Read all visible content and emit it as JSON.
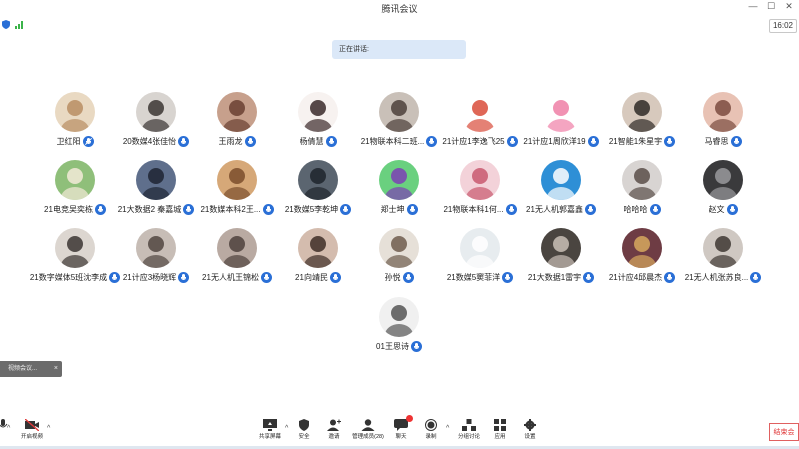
{
  "window": {
    "title": "腾讯会议",
    "minimize": "—",
    "maximize": "☐",
    "close": "✕"
  },
  "status": {
    "time": "16:02",
    "speaking_label": "正在讲话:"
  },
  "participants": [
    {
      "name": "卫红阳",
      "mic": "muted",
      "bg": "#e9d9c2",
      "fg": "#b88d63"
    },
    {
      "name": "20数媒4张佳怡",
      "mic": "on",
      "bg": "#d8d4d0",
      "fg": "#3b3533"
    },
    {
      "name": "王雨龙",
      "mic": "on",
      "bg": "#c7a08c",
      "fg": "#6a3f31"
    },
    {
      "name": "杨倩慧",
      "mic": "on",
      "bg": "#f7f2f0",
      "fg": "#3a2a2a"
    },
    {
      "name": "21物联本科二班...",
      "mic": "on",
      "bg": "#c9c0b8",
      "fg": "#4c3f39"
    },
    {
      "name": "21计应1李逸飞25",
      "mic": "on",
      "bg": "#ffffff",
      "fg": "#d94c3a"
    },
    {
      "name": "21计应1周欣洋19",
      "mic": "on",
      "bg": "#ffffff",
      "fg": "#ef7fa6"
    },
    {
      "name": "21智能1朱星宇",
      "mic": "on",
      "bg": "#d7c9bd",
      "fg": "#2f2a27"
    },
    {
      "name": "马睿思",
      "mic": "on",
      "bg": "#e8c2b4",
      "fg": "#7b4b3f"
    },
    {
      "name": "21电竞吴奕栋",
      "mic": "on",
      "bg": "#8fbf7a",
      "fg": "#f3ead8"
    },
    {
      "name": "21大数据2 秦嘉城",
      "mic": "on",
      "bg": "#5f6f8c",
      "fg": "#1e2533"
    },
    {
      "name": "21数媒本科2王...",
      "mic": "on",
      "bg": "#d6a878",
      "fg": "#7b4e2c"
    },
    {
      "name": "21数媒5李乾坤",
      "mic": "on",
      "bg": "#5b6570",
      "fg": "#1f252c"
    },
    {
      "name": "郑士坤",
      "mic": "on",
      "bg": "#6ad07f",
      "fg": "#7d3fb5"
    },
    {
      "name": "21物联本科1何...",
      "mic": "on",
      "bg": "#f3d2d9",
      "fg": "#c8596e"
    },
    {
      "name": "21无人机郭嘉鑫",
      "mic": "on",
      "bg": "#2e8fd6",
      "fg": "#ffffff"
    },
    {
      "name": "哈哈哈",
      "mic": "on",
      "bg": "#d8d4d2",
      "fg": "#5a4e49"
    },
    {
      "name": "赵文",
      "mic": "on",
      "bg": "#3a3a3c",
      "fg": "#9a9a9c"
    },
    {
      "name": "21数字媒体5班沈李成",
      "mic": "on",
      "bg": "#dcd6d0",
      "fg": "#3b3532"
    },
    {
      "name": "21计应3杨晓辉",
      "mic": "on",
      "bg": "#c7bdb6",
      "fg": "#514741"
    },
    {
      "name": "21无人机王锦松",
      "mic": "on",
      "bg": "#b9aaa2",
      "fg": "#4e423d"
    },
    {
      "name": "21向靖民",
      "mic": "on",
      "bg": "#d4bcae",
      "fg": "#3e2e27"
    },
    {
      "name": "孙悦",
      "mic": "on",
      "bg": "#e6e0d8",
      "fg": "#6e5c4e"
    },
    {
      "name": "21数媒5窦菲洋",
      "mic": "on",
      "bg": "#e7ecef",
      "fg": "#ffffff"
    },
    {
      "name": "21大数据1雷宇",
      "mic": "on",
      "bg": "#4a4540",
      "fg": "#c9bfb6"
    },
    {
      "name": "21计应4邱晨杰",
      "mic": "on",
      "bg": "#6e3c44",
      "fg": "#d7a85e"
    },
    {
      "name": "21无人机张苏良...",
      "mic": "on",
      "bg": "#cfc8c2",
      "fg": "#3e3733"
    },
    {
      "name": "01王思诗",
      "mic": "on",
      "bg": "#f0f0f0",
      "fg": "#555555"
    }
  ],
  "tooltip": {
    "text": "视频会议...",
    "close": "×"
  },
  "toolbar": {
    "mute_label": "",
    "video_label": "开启视频",
    "share_label": "共享屏幕",
    "security_label": "安全",
    "invite_label": "邀请",
    "manage_label": "管理成员(28)",
    "chat_label": "聊天",
    "record_label": "录制",
    "breakout_label": "分组讨论",
    "apps_label": "应用",
    "settings_label": "设置",
    "end_label": "结束会"
  },
  "colors": {
    "accent": "#2a6fd6",
    "danger": "#e03a3a",
    "speaking_bg": "#dbe8f8"
  }
}
